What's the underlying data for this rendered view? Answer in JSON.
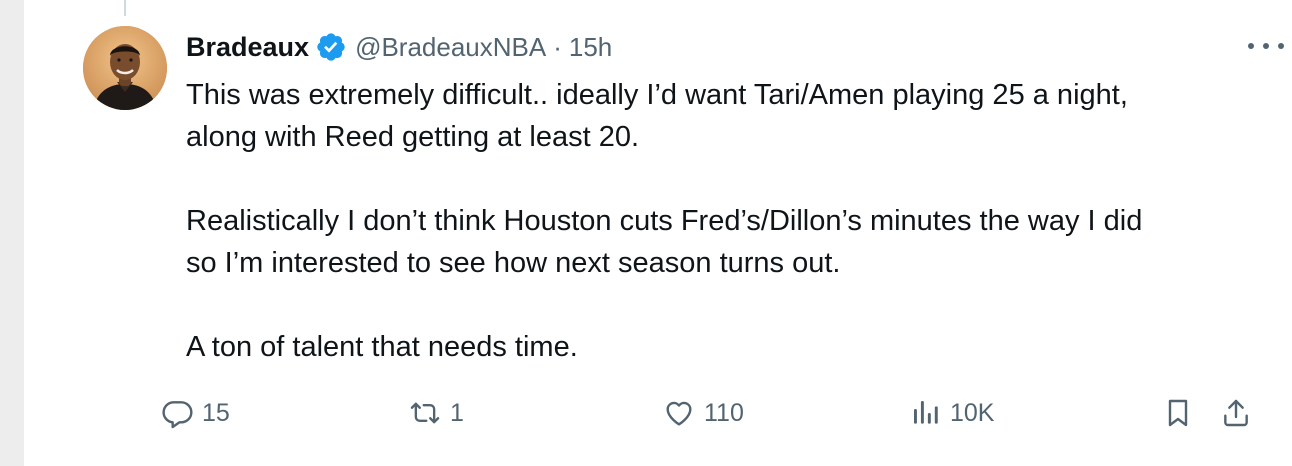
{
  "tweet": {
    "display_name": "Bradeaux",
    "handle": "@BradeauxNBA",
    "separator": "·",
    "time": "15h",
    "paragraphs": [
      [
        "This was extremely difficult.. ideally I’d want Tari/Amen playing 25 a night,",
        "along with Reed getting at least 20."
      ],
      [
        "Realistically I don’t think Houston cuts Fred’s/Dillon’s minutes the way I did",
        "so I’m interested to see how next season turns out."
      ],
      [
        "A ton of talent that needs time."
      ]
    ]
  },
  "actions": {
    "replies": "15",
    "reposts": "1",
    "likes": "110",
    "views": "10K"
  },
  "icons": {
    "verified": "verified-badge-icon",
    "more": "more-horizontal-icon",
    "reply": "reply-icon",
    "repost": "repost-icon",
    "like": "heart-icon",
    "views": "views-icon",
    "bookmark": "bookmark-icon",
    "share": "share-icon"
  },
  "colors": {
    "text": "#0f1419",
    "secondary": "#536471",
    "verified": "#1d9bf0",
    "background": "#ffffff"
  }
}
